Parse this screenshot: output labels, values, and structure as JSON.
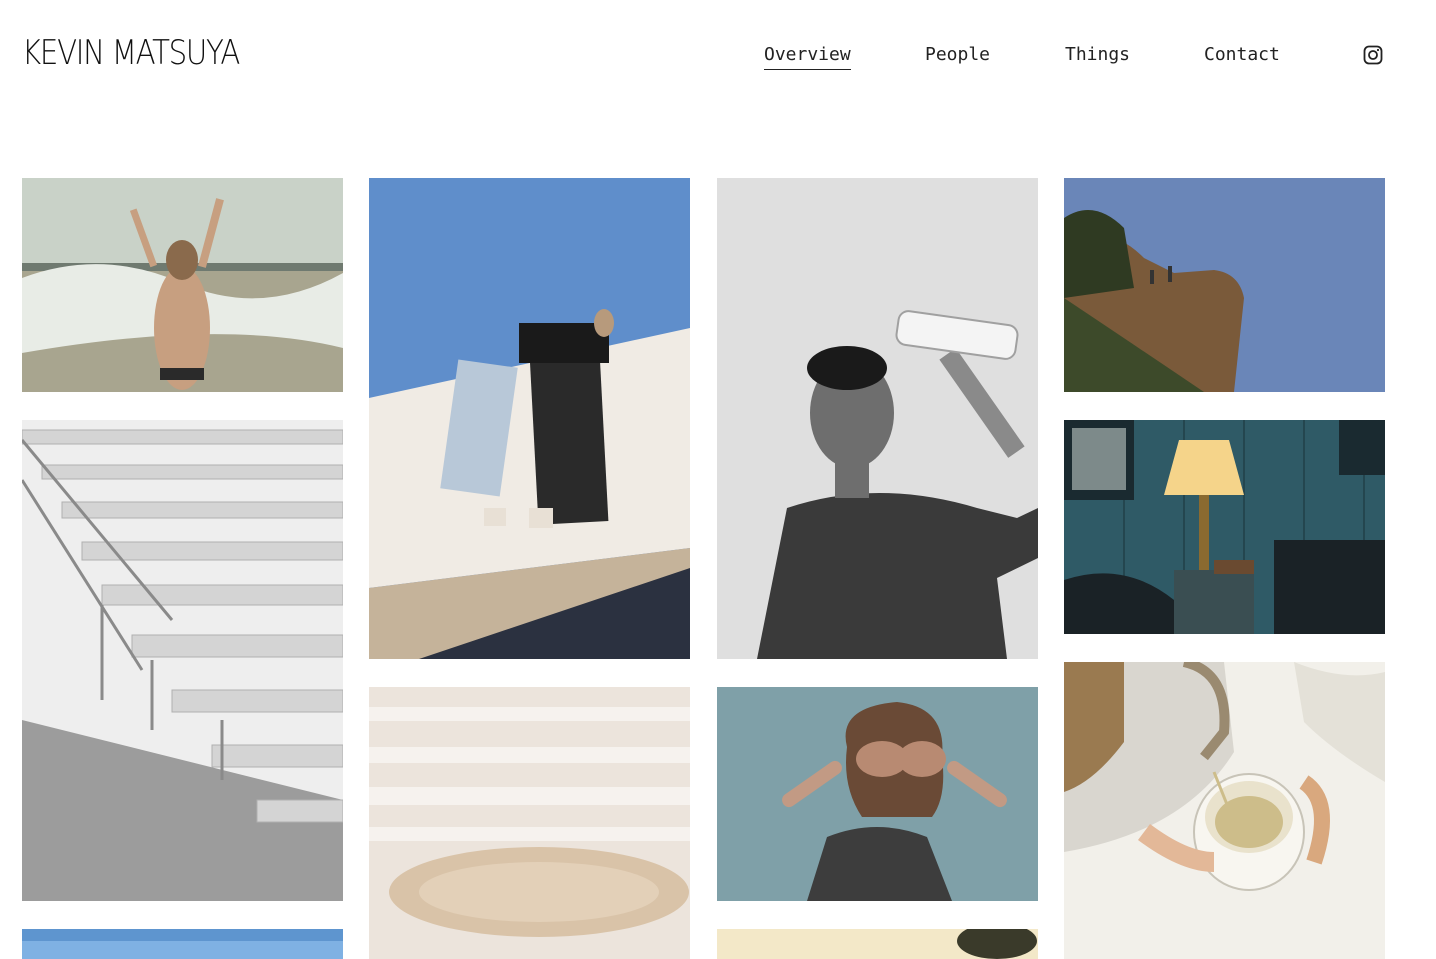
{
  "site": {
    "title": "KEVIN MATSUYA"
  },
  "nav": {
    "items": [
      {
        "label": "Overview",
        "active": true
      },
      {
        "label": "People",
        "active": false
      },
      {
        "label": "Things",
        "active": false
      },
      {
        "label": "Contact",
        "active": false
      }
    ],
    "instagram_icon": "instagram-icon"
  },
  "gallery": {
    "photos": [
      {
        "name": "beach-splash-photo",
        "palette": [
          "#c9d2c8",
          "#e8ece6",
          "#a8a58f"
        ]
      },
      {
        "name": "bleachers-photo",
        "palette": [
          "#d8d8d8",
          "#f2f2f2",
          "#8f8f8f"
        ]
      },
      {
        "name": "sky-photo",
        "palette": [
          "#7fb1e3",
          "#a9cdf0",
          "#5e95cf"
        ]
      },
      {
        "name": "wall-climbers-photo",
        "palette": [
          "#5f8ecb",
          "#f0ebe4",
          "#2a2a2a"
        ]
      },
      {
        "name": "white-terraces-photo",
        "palette": [
          "#ece4dc",
          "#f6f2ee",
          "#d9c3a8"
        ]
      },
      {
        "name": "water-bottle-portrait-photo",
        "palette": [
          "#e6e6e6",
          "#3a3a3a",
          "#1a1a1a"
        ]
      },
      {
        "name": "hands-over-eyes-photo",
        "palette": [
          "#7fa0a8",
          "#c29a84",
          "#3d3d3d"
        ]
      },
      {
        "name": "yellow-photo",
        "palette": [
          "#f3e8c8",
          "#3a3a2a",
          "#d9c48a"
        ]
      },
      {
        "name": "cliff-photo",
        "palette": [
          "#6a86b8",
          "#7a5a3a",
          "#2f3a22"
        ]
      },
      {
        "name": "bedside-lamp-photo",
        "palette": [
          "#2f5a66",
          "#f5d48a",
          "#1a2a30"
        ]
      },
      {
        "name": "kettle-tea-photo",
        "palette": [
          "#f2f0ea",
          "#e9e2cc",
          "#9a7a50"
        ]
      }
    ]
  },
  "colors": {
    "text": "#222222",
    "background": "#ffffff"
  }
}
